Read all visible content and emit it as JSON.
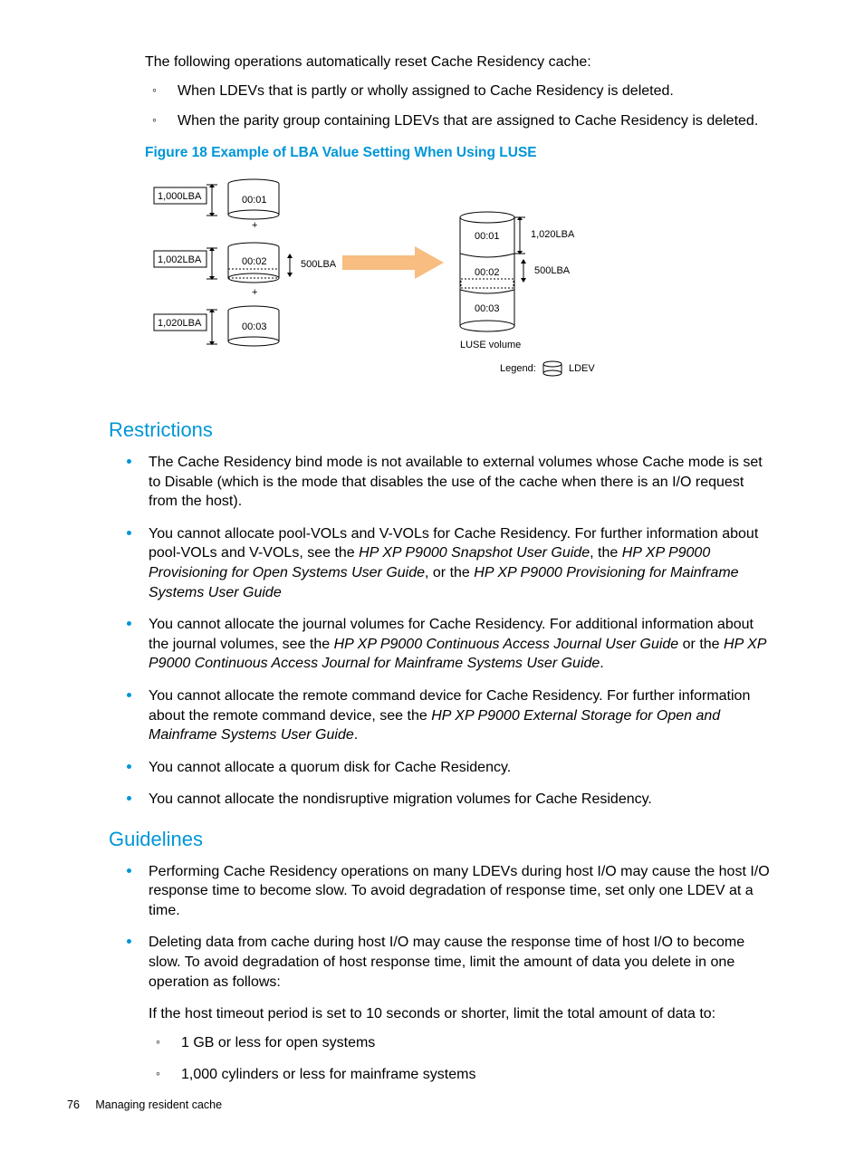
{
  "intro": "The following operations automatically reset Cache Residency cache:",
  "reset_ops": [
    "When LDEVs that is partly or wholly assigned to Cache Residency is deleted.",
    "When the parity group containing LDEVs that are assigned to Cache Residency is deleted."
  ],
  "figure_caption": "Figure 18 Example of LBA Value Setting When Using LUSE",
  "diagram": {
    "left": [
      {
        "lba": "1,000LBA",
        "label": "00:01"
      },
      {
        "lba": "1,002LBA",
        "label": "00:02",
        "mid": "500LBA"
      },
      {
        "lba": "1,020LBA",
        "label": "00:03"
      }
    ],
    "right_labels": [
      "00:01",
      "00:02",
      "00:03"
    ],
    "right_lba_top": "1,020LBA",
    "right_lba_mid": "500LBA",
    "luse": "LUSE volume",
    "legend_word": "Legend:",
    "legend_item": "LDEV",
    "plus": "+"
  },
  "sections": {
    "restrictions": {
      "title": "Restrictions",
      "items": [
        {
          "type": "text",
          "text": "The Cache Residency bind mode is not available to external volumes whose Cache mode is set to Disable (which is the mode that disables the use of the cache when there is an I/O request from the host)."
        },
        {
          "type": "mixed",
          "parts": [
            {
              "t": "You cannot allocate pool-VOLs and V-VOLs for Cache Residency. For further information about pool-VOLs and V-VOLs, see the "
            },
            {
              "t": "HP XP P9000 Snapshot User Guide",
              "i": true
            },
            {
              "t": ", the "
            },
            {
              "t": "HP XP P9000 Provisioning for Open Systems User Guide",
              "i": true
            },
            {
              "t": ", or the "
            },
            {
              "t": "HP XP P9000 Provisioning for Mainframe Systems User Guide",
              "i": true
            }
          ]
        },
        {
          "type": "mixed",
          "parts": [
            {
              "t": "You cannot allocate the journal volumes for Cache Residency. For additional information about the journal volumes, see the "
            },
            {
              "t": "HP XP P9000 Continuous Access Journal User Guide",
              "i": true
            },
            {
              "t": " or the "
            },
            {
              "t": "HP XP P9000 Continuous Access Journal for Mainframe Systems User Guide",
              "i": true
            },
            {
              "t": "."
            }
          ]
        },
        {
          "type": "mixed",
          "parts": [
            {
              "t": "You cannot allocate the remote command device for Cache Residency. For further information about the remote command device, see the "
            },
            {
              "t": "HP XP P9000 External Storage for Open and Mainframe Systems User Guide",
              "i": true
            },
            {
              "t": "."
            }
          ]
        },
        {
          "type": "text",
          "text": "You cannot allocate a quorum disk for Cache Residency."
        },
        {
          "type": "text",
          "text": "You cannot allocate the nondisruptive migration volumes for Cache Residency."
        }
      ]
    },
    "guidelines": {
      "title": "Guidelines",
      "items": [
        {
          "type": "text",
          "text": "Performing Cache Residency operations on many LDEVs during host I/O may cause the host I/O response time to become slow. To avoid degradation of response time, set only one LDEV at a time."
        },
        {
          "type": "text",
          "text": "Deleting data from cache during host I/O may cause the response time of host I/O to become slow. To avoid degradation of host response time, limit the amount of data you delete in one operation as follows:"
        }
      ],
      "sub_intro": "If the host timeout period is set to 10 seconds or shorter, limit the total amount of data to:",
      "sub_items": [
        "1 GB or less for open systems",
        "1,000 cylinders or less for mainframe systems"
      ]
    }
  },
  "footer": {
    "page": "76",
    "title": "Managing resident cache"
  }
}
